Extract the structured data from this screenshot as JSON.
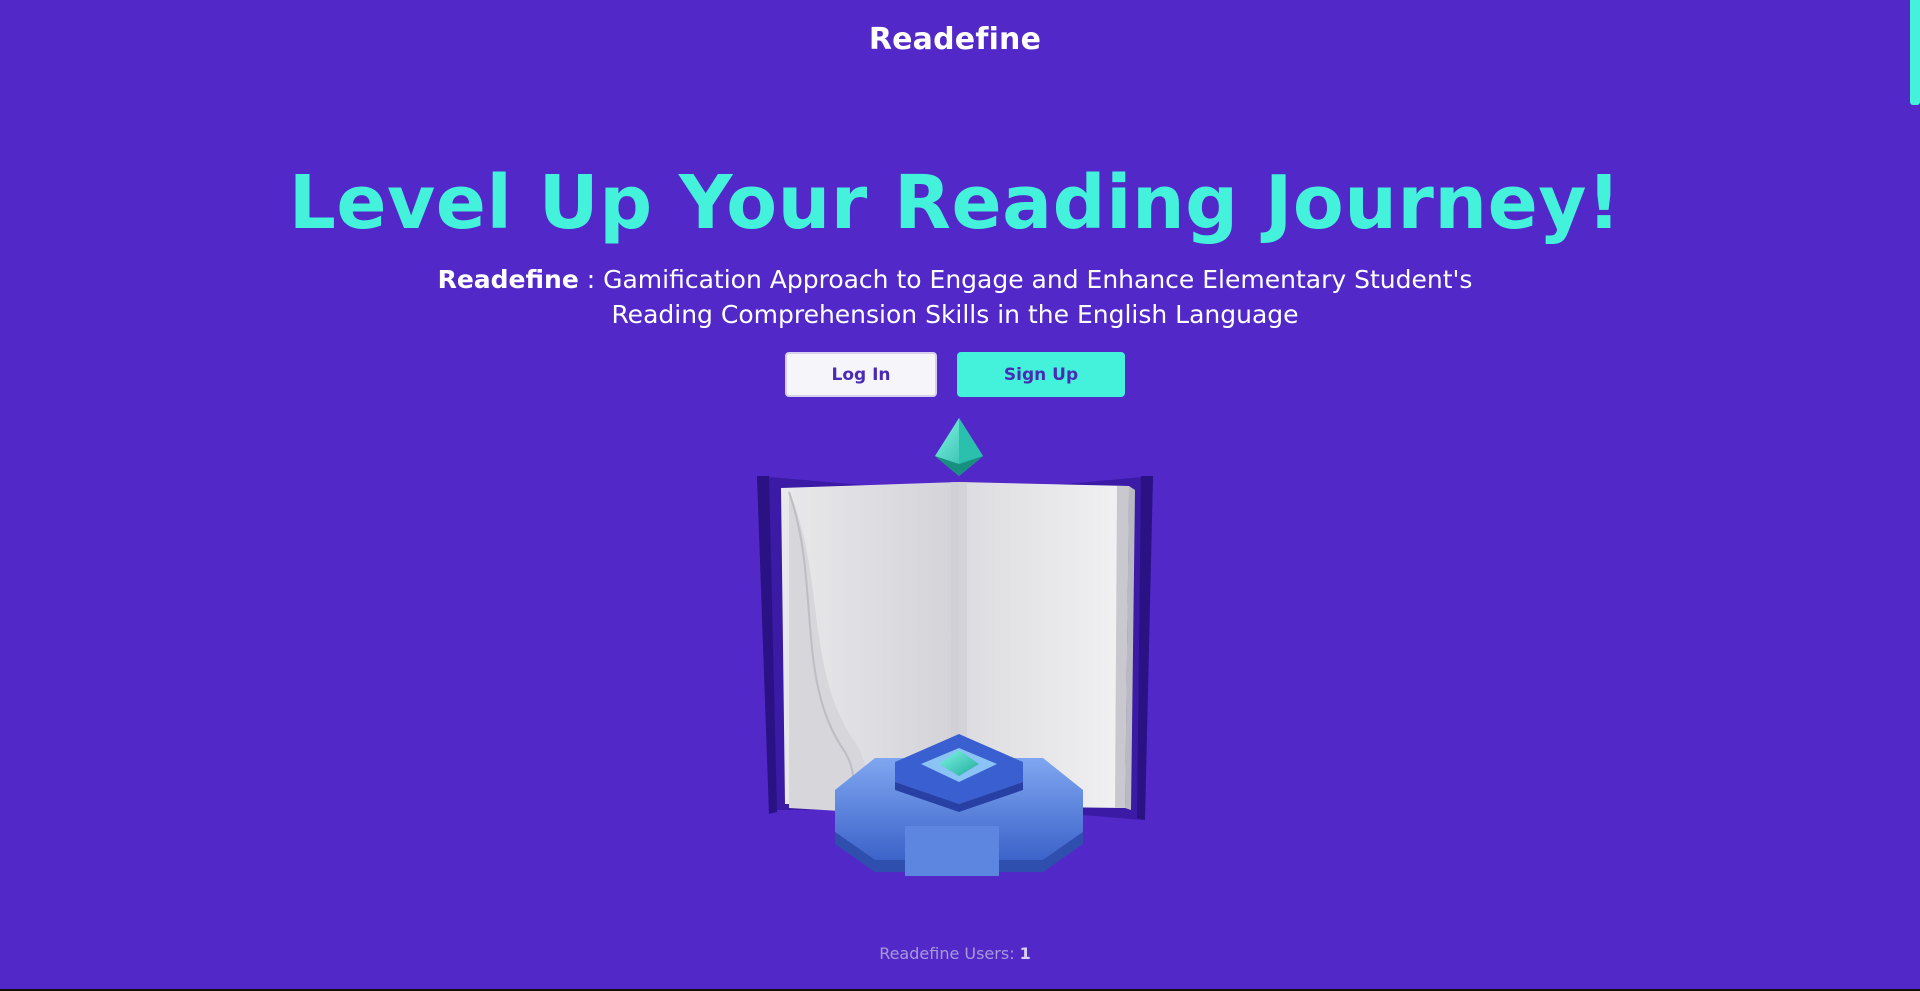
{
  "header": {
    "brand": "Readefine"
  },
  "hero": {
    "title": "Level Up Your Reading Journey!",
    "subtitle_brand": "Readefine",
    "subtitle_line1": " : Gamification Approach to Engage and Enhance Elementary Student's",
    "subtitle_line2": "Reading Comprehension Skills in the English Language"
  },
  "actions": {
    "login_label": "Log In",
    "signup_label": "Sign Up"
  },
  "footer": {
    "users_label": "Readefine Users: ",
    "users_count": "1"
  },
  "illustration": {
    "icon": "open-book-with-gem-icon"
  },
  "colors": {
    "background": "#5229c8",
    "accent": "#44f2dc",
    "text": "#ffffff"
  }
}
